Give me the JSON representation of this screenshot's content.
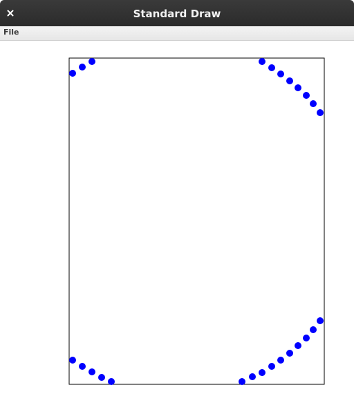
{
  "window": {
    "title": "Standard Draw"
  },
  "menu": {
    "file_label": "File"
  },
  "colors": {
    "titlebar": "#2f2f2f",
    "dot": "#0000ff",
    "frame": "#000000",
    "background": "#ffffff"
  },
  "icons": {
    "close": "close-icon"
  }
}
